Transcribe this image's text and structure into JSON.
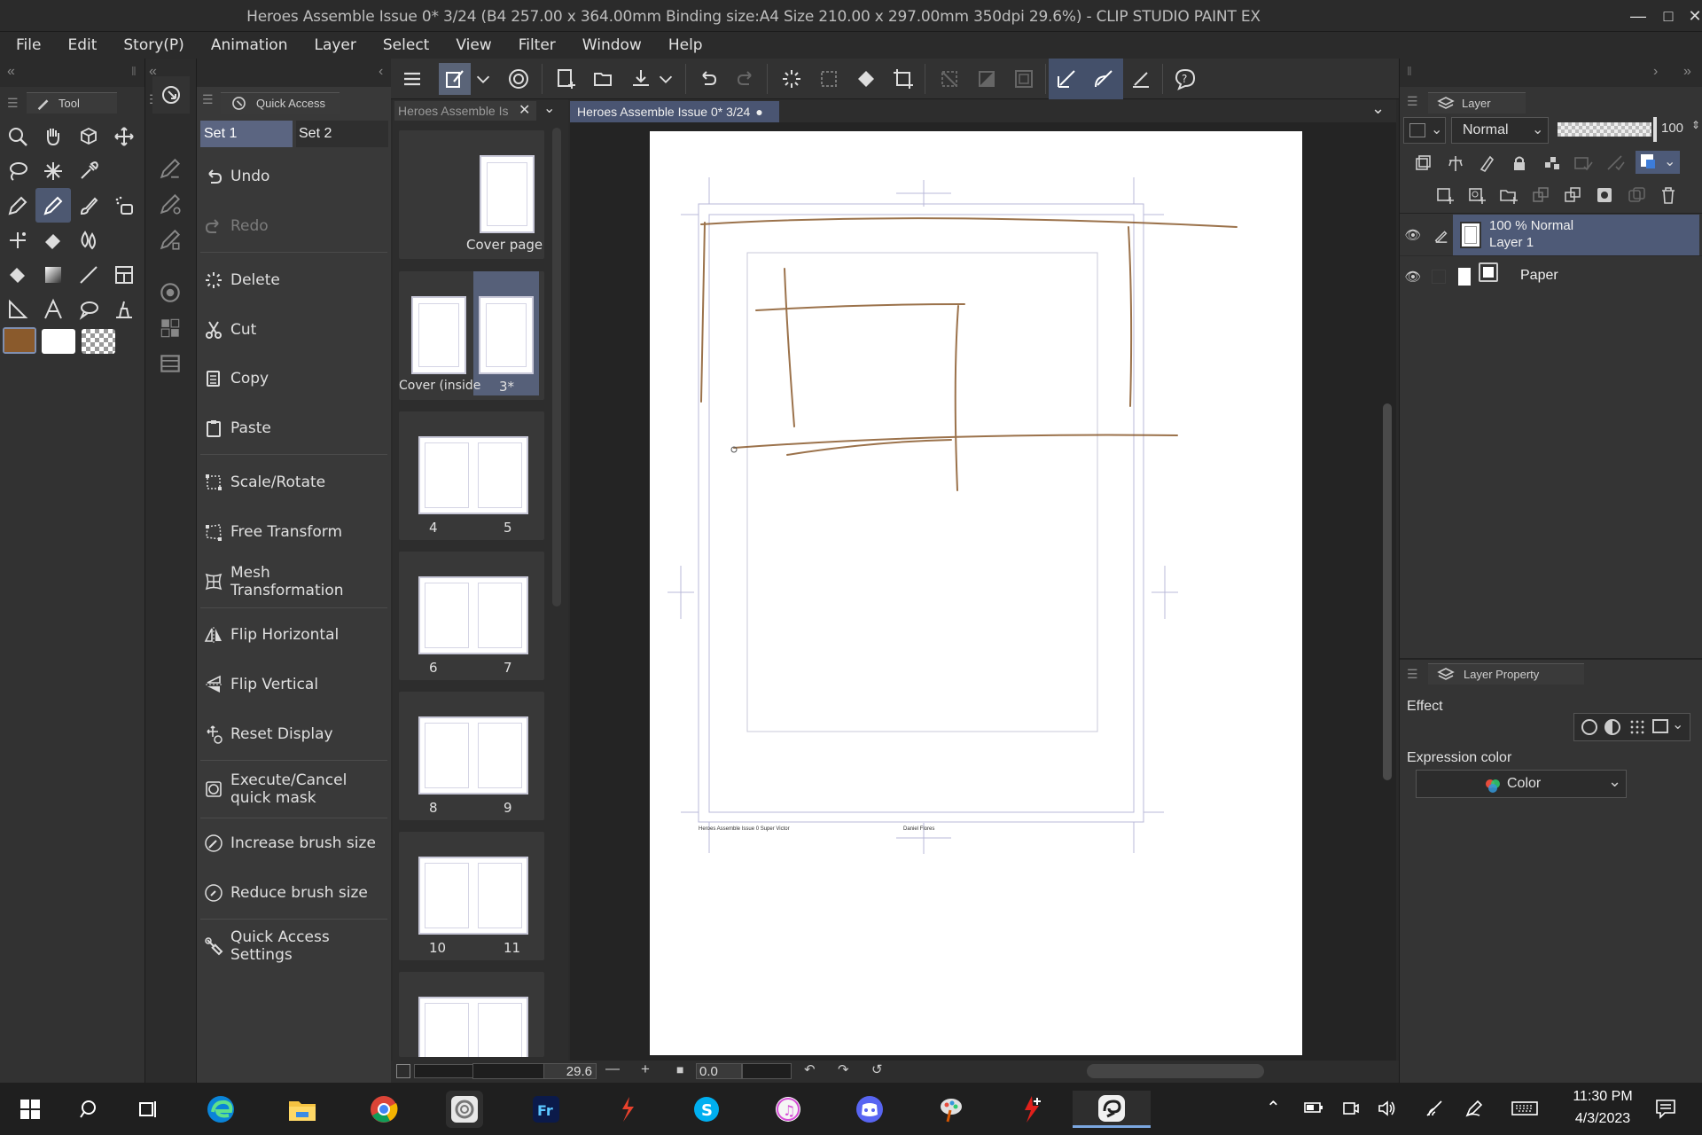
{
  "window": {
    "title": "Heroes Assemble Issue 0* 3/24 (B4 257.00 x 364.00mm Binding size:A4 Size 210.00 x 297.00mm 350dpi 29.6%)  - CLIP STUDIO PAINT EX"
  },
  "menu": [
    "File",
    "Edit",
    "Story(P)",
    "Animation",
    "Layer",
    "Select",
    "View",
    "Filter",
    "Window",
    "Help"
  ],
  "tool_panel": {
    "tab": "Tool"
  },
  "quick_access": {
    "tab": "Quick Access",
    "sets": [
      "Set 1",
      "Set 2"
    ],
    "items": [
      {
        "label": "Undo",
        "icon": "undo-icon"
      },
      {
        "label": "Redo",
        "icon": "redo-icon",
        "disabled": true
      },
      {
        "label": "Delete",
        "icon": "delete-icon"
      },
      {
        "label": "Cut",
        "icon": "scissors-icon"
      },
      {
        "label": "Copy",
        "icon": "copy-icon"
      },
      {
        "label": "Paste",
        "icon": "paste-icon"
      },
      {
        "label": "Scale/Rotate",
        "icon": "scale-rotate-icon"
      },
      {
        "label": "Free Transform",
        "icon": "free-transform-icon"
      },
      {
        "label": "Mesh Transformation",
        "icon": "mesh-icon"
      },
      {
        "label": "Flip Horizontal",
        "icon": "flip-horizontal-icon"
      },
      {
        "label": "Flip Vertical",
        "icon": "flip-vertical-icon"
      },
      {
        "label": "Reset Display",
        "icon": "reset-display-icon"
      },
      {
        "label": "Execute/Cancel quick mask",
        "icon": "quick-mask-icon"
      },
      {
        "label": "Increase brush size",
        "icon": "brush-plus-icon"
      },
      {
        "label": "Reduce brush size",
        "icon": "brush-minus-icon"
      },
      {
        "label": "Quick Access Settings",
        "icon": "settings-icon"
      }
    ]
  },
  "pages_panel": {
    "tab": "Heroes Assemble Is",
    "cover": "Cover page",
    "cover_inside": "Cover (inside",
    "current": "3*",
    "spreads": [
      [
        "4",
        "5"
      ],
      [
        "6",
        "7"
      ],
      [
        "8",
        "9"
      ],
      [
        "10",
        "11"
      ]
    ]
  },
  "document_tab": "Heroes Assemble Issue 0* 3/24",
  "canvas": {
    "footer_left": "Heroes Assemble Issue 0 Super Victor",
    "footer_center": "Daniel Flores"
  },
  "bottom_bar": {
    "zoom": "29.6",
    "angle": "0.0"
  },
  "layer_panel": {
    "tab": "Layer",
    "blend_mode": "Normal",
    "opacity": "100",
    "layers": [
      {
        "mode": "100 % Normal",
        "name": "Layer 1",
        "selected": true
      },
      {
        "name": "Paper",
        "selected": false
      }
    ]
  },
  "layer_property": {
    "tab": "Layer Property",
    "effect_label": "Effect",
    "expression_label": "Expression color",
    "expression_value": "Color"
  },
  "taskbar": {
    "time": "11:30 PM",
    "date": "4/3/2023",
    "apps": [
      "windows-start-icon",
      "search-icon",
      "task-view-icon",
      "edge-icon",
      "file-explorer-icon",
      "chrome-icon",
      "clip-studio-icon",
      "fresco-icon",
      "swift-icon",
      "skype-icon",
      "itunes-icon",
      "discord-icon",
      "paint-icon",
      "red-app-icon",
      "clip-studio-paint-icon"
    ]
  },
  "colors": {
    "main": "#8a5a2c",
    "sub": "#ffffff",
    "accent": "#5a6478"
  }
}
